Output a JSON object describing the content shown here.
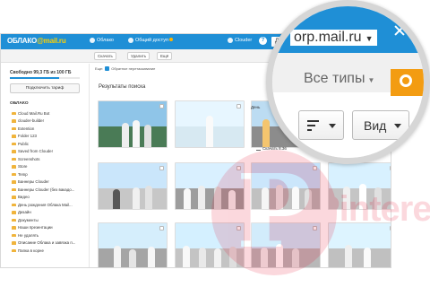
{
  "header": {
    "logo_text": "ОБЛАКО",
    "logo_domain": "@mail.ru",
    "nav": [
      {
        "label": "Облако",
        "icon": "cloud-icon"
      },
      {
        "label": "Общий доступ",
        "icon": "shared-icon"
      },
      {
        "label": "Clouder",
        "icon": "clouder-icon"
      }
    ],
    "search_text": "Де"
  },
  "toolbar": {
    "download": "Скачать",
    "delete": "Удалить",
    "more": "Ещё",
    "filter_label": "Еще:",
    "filter_text": "Обратное перетаскивание"
  },
  "sidebar": {
    "quota_text": "Свободно 99,3 ГБ из 100 ГБ",
    "quota_used": 0.7,
    "plan_button": "Подключить тариф",
    "section_title": "ОБЛАКО",
    "folders": [
      "Cloud Mail.Ru Bot",
      "clouder-builder",
      "Extention",
      "Folder 123",
      "Public",
      "Saved from Clouder",
      "Screenshots",
      "Store",
      "Temp",
      "Баннеры Clouder",
      "Баннеры Clouder (без вакадо...",
      "Видео",
      "День рождения Облака Mail...",
      "Дизайн",
      "Документы",
      "Наши презентации",
      "Не удалять",
      "Описание Облака и завязка п...",
      "Папка в корне"
    ]
  },
  "main": {
    "title": "Результаты поиска",
    "selected_label": "День",
    "download_text": "Скачать 8.36"
  },
  "magnifier": {
    "domain": "orp.mail.ru",
    "types": "Все типы",
    "view": "Вид"
  },
  "watermark": {
    "logo": "P",
    "text": "Pinterest"
  }
}
